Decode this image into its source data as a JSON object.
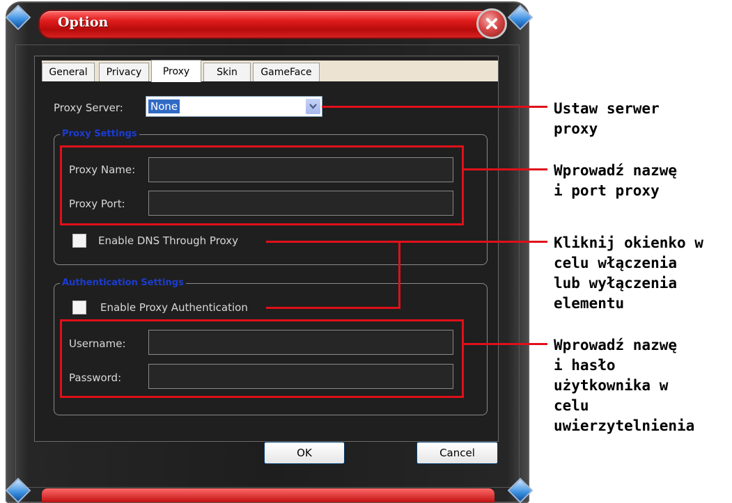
{
  "window": {
    "title": "Option"
  },
  "tabs": [
    {
      "label": "General",
      "active": false
    },
    {
      "label": "Privacy",
      "active": false
    },
    {
      "label": "Proxy",
      "active": true
    },
    {
      "label": "Skin",
      "active": false
    },
    {
      "label": "GameFace",
      "active": false
    }
  ],
  "proxy_server": {
    "label": "Proxy Server:",
    "value": "None"
  },
  "proxy_settings": {
    "legend": "Proxy Settings",
    "name_label": "Proxy Name:",
    "name_value": "",
    "port_label": "Proxy Port:",
    "port_value": "",
    "dns_checkbox_label": "Enable DNS Through Proxy",
    "dns_checked": false
  },
  "auth_settings": {
    "legend": "Authentication Settings",
    "auth_checkbox_label": "Enable Proxy Authentication",
    "auth_checked": false,
    "username_label": "Username:",
    "username_value": "",
    "password_label": "Password:",
    "password_value": ""
  },
  "buttons": {
    "ok": "OK",
    "cancel": "Cancel"
  },
  "callouts": {
    "server": [
      "Ustaw serwer",
      "proxy"
    ],
    "name_port": [
      "Wprowadź nazwę",
      "i port proxy"
    ],
    "checkbox": [
      "Kliknij okienko w",
      "celu włączenia",
      "lub wyłączenia",
      "elementu"
    ],
    "credentials": [
      "Wprowadź nazwę",
      "i hasło",
      "użytkownika w",
      "celu",
      "uwierzytelnienia"
    ]
  },
  "colors": {
    "highlight": "#e0101a",
    "title_bar": "#d61a1a",
    "dialog_bg": "#1f1f1f",
    "legend": "#1b3cd1"
  }
}
